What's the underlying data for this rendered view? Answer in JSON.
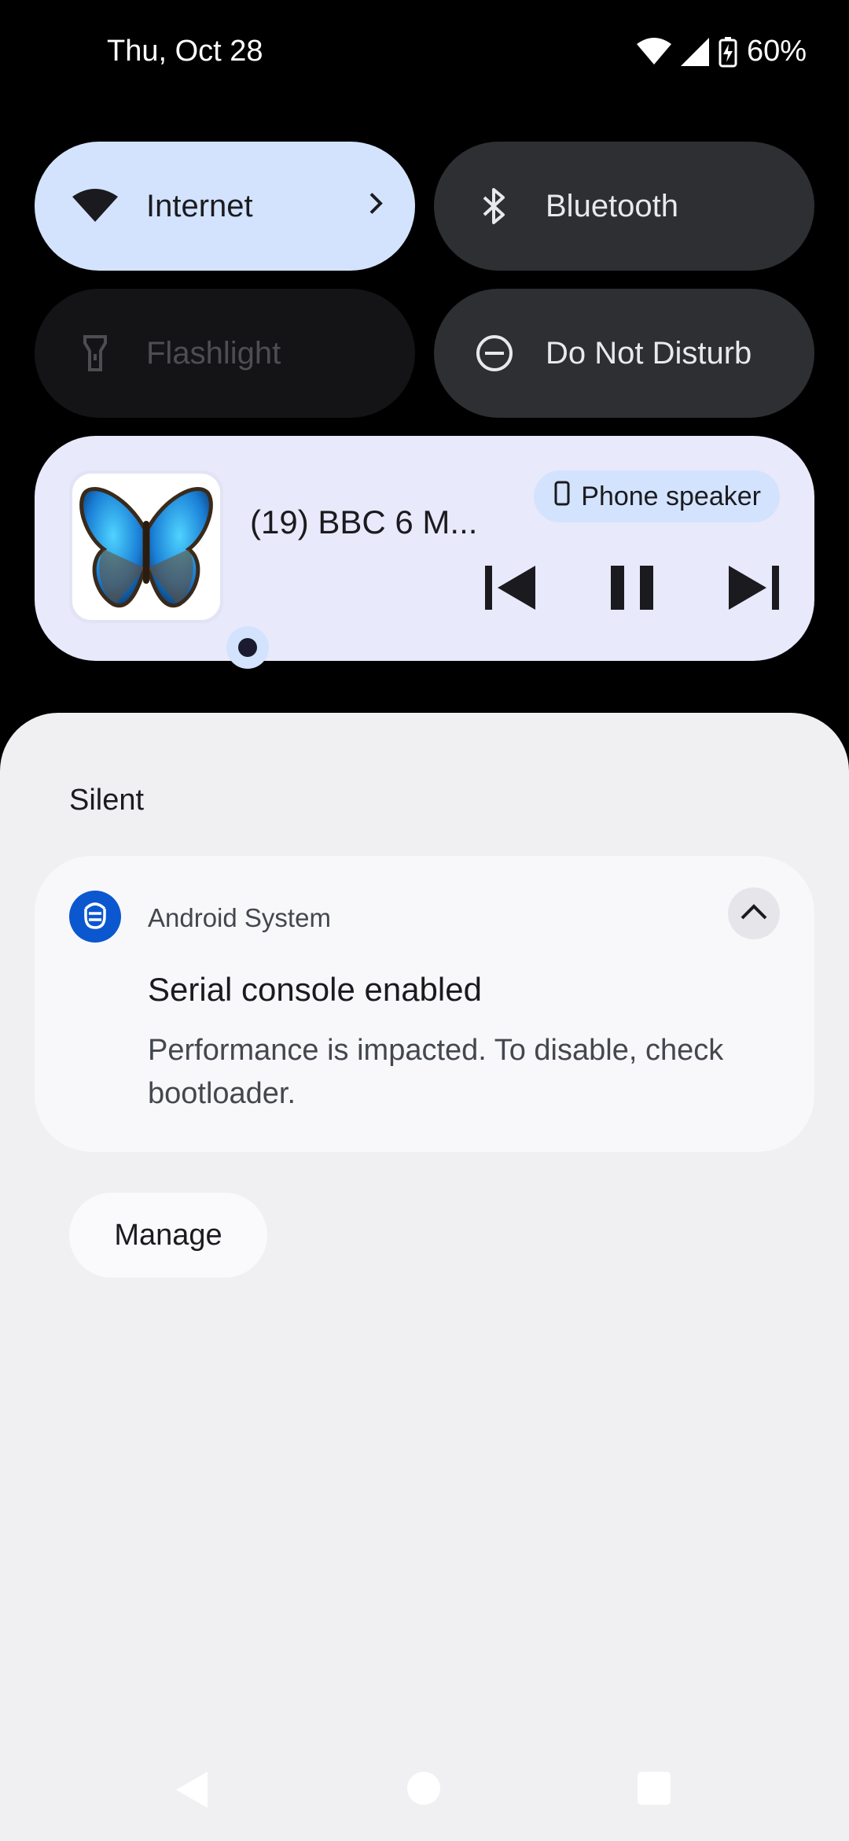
{
  "status_bar": {
    "date": "Thu, Oct 28",
    "battery": "60%",
    "icons": [
      "wifi-icon",
      "signal-icon",
      "battery-charging-icon"
    ]
  },
  "tiles": [
    {
      "label": "Internet",
      "icon": "wifi-icon",
      "state": "on"
    },
    {
      "label": "Bluetooth",
      "icon": "bluetooth-icon",
      "state": "off"
    },
    {
      "label": "Flashlight",
      "icon": "flashlight-icon",
      "state": "unavailable"
    },
    {
      "label": "Do Not Disturb",
      "icon": "dnd-icon",
      "state": "off"
    }
  ],
  "media": {
    "title": "(19) BBC 6 M...",
    "output": "Phone speaker",
    "controls": [
      "skip-previous-icon",
      "pause-icon",
      "skip-next-icon"
    ]
  },
  "notifications": {
    "section": "Silent",
    "items": [
      {
        "app": "Android System",
        "title": "Serial console enabled",
        "body": "Performance is impacted. To disable, check bootloader."
      }
    ],
    "manage_label": "Manage"
  },
  "colors": {
    "tile_on": "#d3e3fd",
    "tile_off": "#2d2f33",
    "media_bg": "#e8e9fb",
    "shade_bg": "#f0f0f3",
    "app_icon": "#0b57d0"
  }
}
